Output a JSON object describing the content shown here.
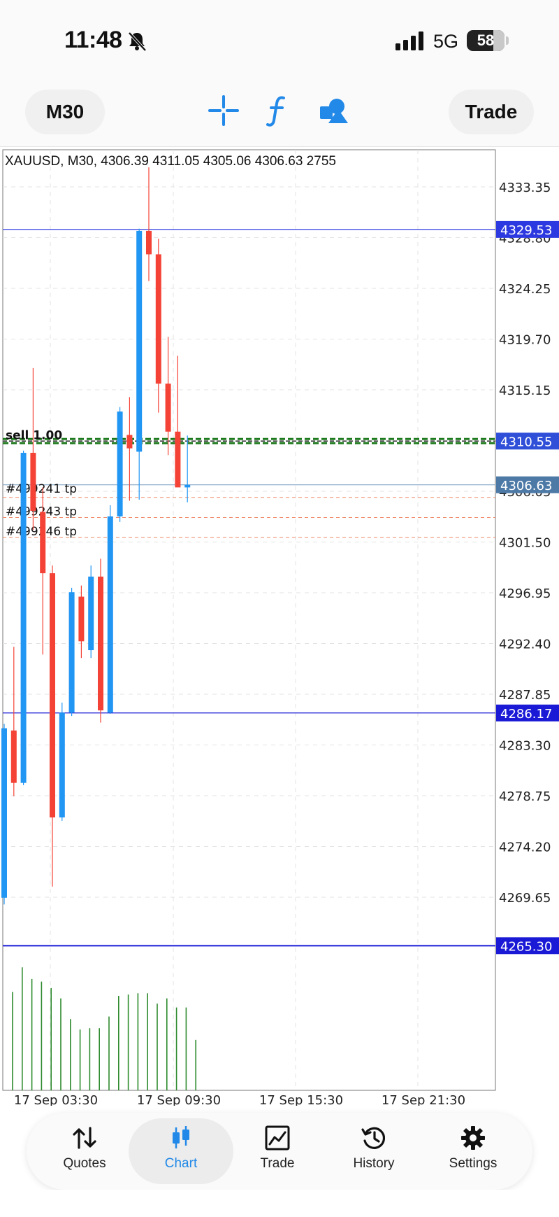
{
  "status_bar": {
    "time": "11:48",
    "network": "5G",
    "battery": "58",
    "battery_level_percent": 58
  },
  "toolbar": {
    "timeframe_label": "M30",
    "trade_label": "Trade",
    "icons": [
      "crosshair-icon",
      "indicators-icon",
      "objects-icon"
    ],
    "accent_color": "#2289e8"
  },
  "chart": {
    "header": "XAUUSD, M30, 4306.39 4311.05 4305.06 4306.63 2755",
    "price_ticks": [
      "4333.35",
      "4328.80",
      "4324.25",
      "4319.70",
      "4315.15",
      "4310.60",
      "4306.05",
      "4301.50",
      "4296.95",
      "4292.40",
      "4287.85",
      "4283.30",
      "4278.75",
      "4274.20",
      "4269.65"
    ],
    "time_ticks": [
      "17 Sep 03:30",
      "17 Sep 09:30",
      "17 Sep 15:30",
      "17 Sep 21:30"
    ],
    "price_tags": [
      {
        "label": "4329.53",
        "price": 4329.53,
        "color": "#2d39e0"
      },
      {
        "label": "4310.55",
        "price": 4310.55,
        "color": "#2f4fd8"
      },
      {
        "label": "4306.63",
        "price": 4306.63,
        "color": "#4d79a6"
      },
      {
        "label": "4286.17",
        "price": 4286.17,
        "color": "#1a1ad6"
      },
      {
        "label": "4265.30",
        "price": 4265.3,
        "color": "#1a1ad6"
      }
    ],
    "position_label": "sell 1.00",
    "order_labels": [
      "#499241 tp",
      "#499243 tp",
      "#499246 tp"
    ],
    "bull_color": "#2196f3",
    "bear_color": "#f44336",
    "volume_color": "#2e8b2e"
  },
  "chart_data": {
    "type": "candlestick",
    "symbol": "XAUUSD",
    "timeframe": "M30",
    "ylim": [
      4263.5,
      4335.3
    ],
    "candles": [
      {
        "o": 4269.6,
        "h": 4285.2,
        "l": 4269.0,
        "c": 4284.8
      },
      {
        "o": 4284.6,
        "h": 4292.1,
        "l": 4278.7,
        "c": 4279.9
      },
      {
        "o": 4279.9,
        "h": 4309.7,
        "l": 4279.7,
        "c": 4309.5
      },
      {
        "o": 4309.5,
        "h": 4317.1,
        "l": 4302.6,
        "c": 4304.3
      },
      {
        "o": 4304.2,
        "h": 4306.4,
        "l": 4291.4,
        "c": 4298.7
      },
      {
        "o": 4298.7,
        "h": 4299.4,
        "l": 4270.6,
        "c": 4276.8
      },
      {
        "o": 4276.8,
        "h": 4287.1,
        "l": 4276.5,
        "c": 4286.2
      },
      {
        "o": 4286.2,
        "h": 4297.4,
        "l": 4285.9,
        "c": 4297.0
      },
      {
        "o": 4296.6,
        "h": 4297.6,
        "l": 4291.1,
        "c": 4292.6
      },
      {
        "o": 4291.8,
        "h": 4299.4,
        "l": 4291.1,
        "c": 4298.4
      },
      {
        "o": 4298.4,
        "h": 4300.0,
        "l": 4285.3,
        "c": 4286.4
      },
      {
        "o": 4286.2,
        "h": 4304.8,
        "l": 4286.1,
        "c": 4303.8
      },
      {
        "o": 4303.8,
        "h": 4313.6,
        "l": 4303.3,
        "c": 4313.2
      },
      {
        "o": 4311.1,
        "h": 4314.5,
        "l": 4305.2,
        "c": 4309.9
      },
      {
        "o": 4309.6,
        "h": 4329.6,
        "l": 4305.3,
        "c": 4329.4
      },
      {
        "o": 4329.4,
        "h": 4335.1,
        "l": 4324.9,
        "c": 4327.3
      },
      {
        "o": 4327.3,
        "h": 4328.7,
        "l": 4313.1,
        "c": 4315.7
      },
      {
        "o": 4315.7,
        "h": 4319.9,
        "l": 4309.3,
        "c": 4311.4
      },
      {
        "o": 4311.4,
        "h": 4318.2,
        "l": 4306.4,
        "c": 4306.4
      },
      {
        "o": 4306.4,
        "h": 4311.05,
        "l": 4305.06,
        "c": 4306.63
      }
    ],
    "volumes": [
      0.76,
      0.95,
      0.86,
      0.84,
      0.79,
      0.71,
      0.55,
      0.47,
      0.48,
      0.48,
      0.57,
      0.73,
      0.74,
      0.75,
      0.75,
      0.67,
      0.71,
      0.64,
      0.64,
      0.39
    ],
    "xlabels": [
      "17 Sep 03:30",
      "17 Sep 09:30",
      "17 Sep 15:30",
      "17 Sep 21:30"
    ],
    "grid": true
  },
  "nav": [
    {
      "label": "Quotes",
      "icon": "quotes-icon",
      "active": false
    },
    {
      "label": "Chart",
      "icon": "chart-icon",
      "active": true
    },
    {
      "label": "Trade",
      "icon": "trade-icon",
      "active": false
    },
    {
      "label": "History",
      "icon": "history-icon",
      "active": false
    },
    {
      "label": "Settings",
      "icon": "settings-icon",
      "active": false
    }
  ]
}
